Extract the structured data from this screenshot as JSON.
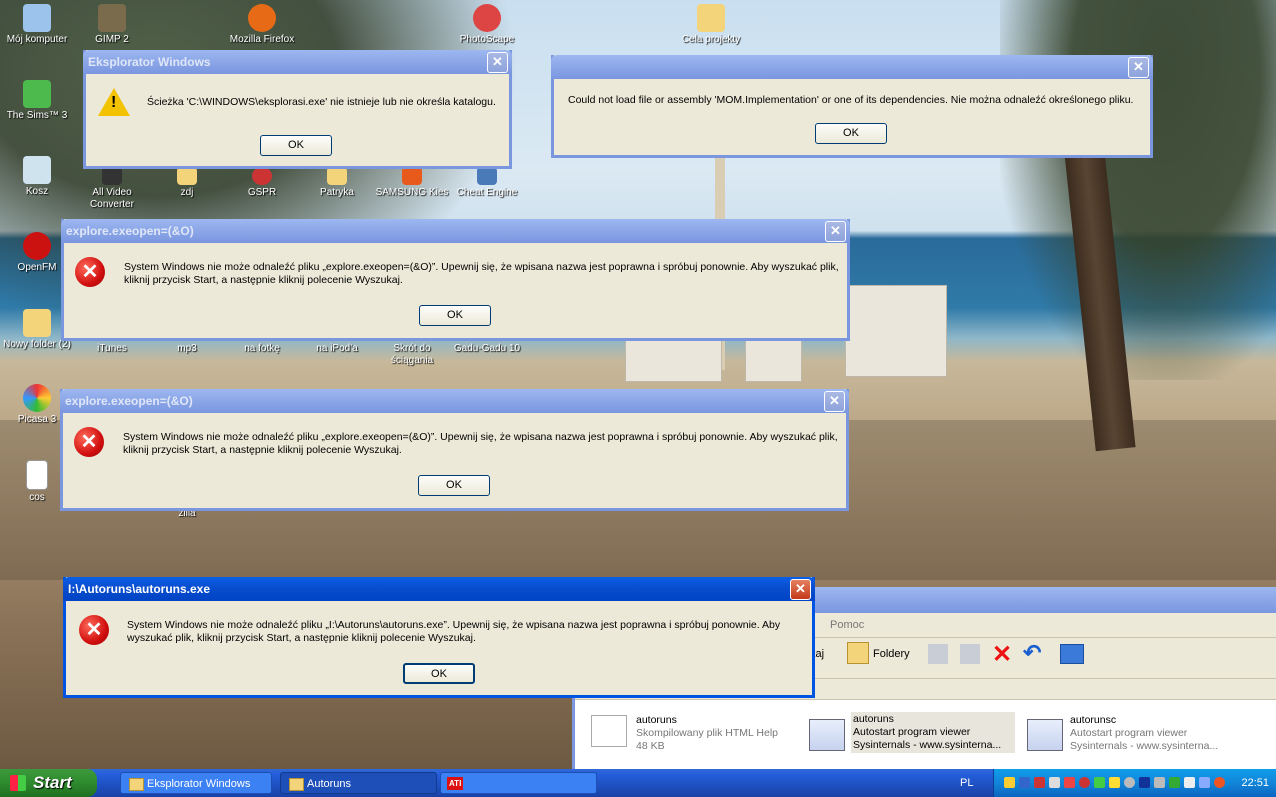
{
  "desktop": {
    "icons": [
      {
        "label": "Mój komputer"
      },
      {
        "label": "GIMP 2"
      },
      {
        "label": "Mozilla Firefox"
      },
      {
        "label": "PhotoScape"
      },
      {
        "label": "Cela projekty"
      },
      {
        "label": "The Sims™ 3"
      },
      {
        "label": "Kosz"
      },
      {
        "label": "All Video Converter"
      },
      {
        "label": "zdj"
      },
      {
        "label": "GSPR"
      },
      {
        "label": "Patryka"
      },
      {
        "label": "SAMSUNG Kies"
      },
      {
        "label": "Cheat Engine"
      },
      {
        "label": "OpenFM"
      },
      {
        "label": "Nowy folder (2)"
      },
      {
        "label": "iTunes"
      },
      {
        "label": "mp3"
      },
      {
        "label": "na fotkę"
      },
      {
        "label": "na iPod'a"
      },
      {
        "label": "Skrót do ściągania"
      },
      {
        "label": "Gadu-Gadu 10"
      },
      {
        "label": "Picasa 3"
      },
      {
        "label": "cos"
      },
      {
        "label": "zilla"
      }
    ]
  },
  "dialogs": {
    "d1": {
      "title": "Eksplorator Windows",
      "message": "Ścieżka 'C:\\WINDOWS\\eksplorasi.exe' nie istnieje lub nie określa katalogu.",
      "ok": "OK",
      "icon": "warning-icon"
    },
    "d2": {
      "title": "",
      "message": "Could not load file or assembly 'MOM.Implementation' or one of its dependencies. Nie można odnaleźć określonego pliku.",
      "ok": "OK"
    },
    "d3": {
      "title": "explore.exeopen=(&O)",
      "message": "System Windows nie może odnaleźć pliku „explore.exeopen=(&O)”. Upewnij się, że wpisana nazwa jest poprawna i spróbuj ponownie. Aby wyszukać plik, kliknij przycisk Start, a następnie kliknij polecenie Wyszukaj.",
      "ok": "OK",
      "icon": "error-icon"
    },
    "d4": {
      "title": "explore.exeopen=(&O)",
      "message": "System Windows nie może odnaleźć pliku „explore.exeopen=(&O)”. Upewnij się, że wpisana nazwa jest poprawna i spróbuj ponownie. Aby wyszukać plik, kliknij przycisk Start, a następnie kliknij polecenie Wyszukaj.",
      "ok": "OK",
      "icon": "error-icon"
    },
    "d5": {
      "title": "I:\\Autoruns\\autoruns.exe",
      "message": "System Windows nie może odnaleźć pliku „I:\\Autoruns\\autoruns.exe”. Upewnij się, że wpisana nazwa jest poprawna i spróbuj ponownie. Aby wyszukać plik, kliknij przycisk Start, a następnie kliknij polecenie Wyszukaj.",
      "ok": "OK",
      "icon": "error-icon"
    }
  },
  "explorer": {
    "menu_help": "Pomoc",
    "toolbar_search_partial": "kaj",
    "toolbar_folders": "Foldery",
    "files": [
      {
        "name": "autoruns",
        "line2": "Skompilowany plik HTML Help",
        "line3": "48 KB"
      },
      {
        "name": "autoruns",
        "line2": "Autostart program viewer",
        "line3": "Sysinternals - www.sysinterna..."
      },
      {
        "name": "autorunsc",
        "line2": "Autostart program viewer",
        "line3": "Sysinternals - www.sysinterna..."
      }
    ]
  },
  "taskbar": {
    "start_label": "Start",
    "buttons": [
      {
        "label": "Eksplorator Windows"
      },
      {
        "label": "Autoruns"
      },
      {
        "label": ""
      }
    ],
    "ati_label": "ATI",
    "language": "PL",
    "clock": "22:51"
  },
  "colors": {
    "titlebar_active": "#0054e3",
    "titlebar_inactive": "#7a96df",
    "dialog_bg": "#ece9d8",
    "taskbar": "#245edb",
    "start_green": "#2e8a2e"
  }
}
